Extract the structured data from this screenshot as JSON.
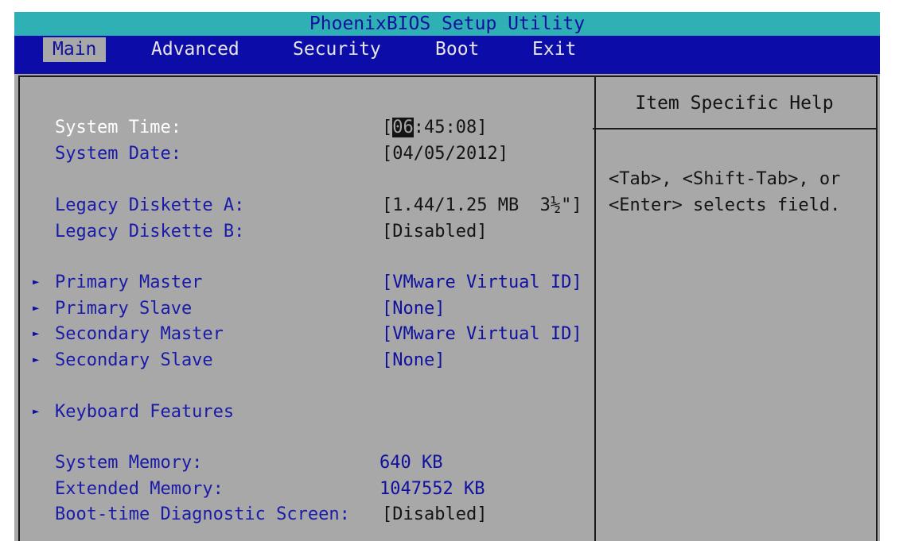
{
  "title": "PhoenixBIOS Setup Utility",
  "menu": {
    "tabs": [
      "Main",
      "Advanced",
      "Security",
      "Boot",
      "Exit"
    ],
    "active": "Main"
  },
  "main": {
    "system_time": {
      "label": "System Time:",
      "open": "[",
      "hour": "06",
      "rest": ":45:08]"
    },
    "system_date": {
      "label": "System Date:",
      "value": "[04/05/2012]"
    },
    "legacy_a": {
      "label": "Legacy Diskette A:",
      "value": "[1.44/1.25 MB  3½\"]"
    },
    "legacy_b": {
      "label": "Legacy Diskette B:",
      "value": "[Disabled]"
    },
    "primary_master": {
      "label": "Primary Master",
      "value": "[VMware Virtual ID]"
    },
    "primary_slave": {
      "label": "Primary Slave",
      "value": "[None]"
    },
    "secondary_master": {
      "label": "Secondary Master",
      "value": "[VMware Virtual ID]"
    },
    "secondary_slave": {
      "label": "Secondary Slave",
      "value": "[None]"
    },
    "keyboard": {
      "label": "Keyboard Features"
    },
    "system_memory": {
      "label": "System Memory:",
      "value": "640 KB"
    },
    "extended_memory": {
      "label": "Extended Memory:",
      "value": "1047552 KB"
    },
    "boot_diag": {
      "label": "Boot-time Diagnostic Screen:",
      "value": "[Disabled]"
    },
    "submenu_arrow": "►"
  },
  "help": {
    "title": "Item Specific Help",
    "text": "<Tab>, <Shift-Tab>, or\n<Enter> selects field."
  },
  "colors": {
    "title_bar": "#2fb0b4",
    "menu_bar": "#0c0ca8",
    "background": "#a8a8a8",
    "label_text": "#1a1aa8",
    "selected_text": "#ffffff"
  }
}
